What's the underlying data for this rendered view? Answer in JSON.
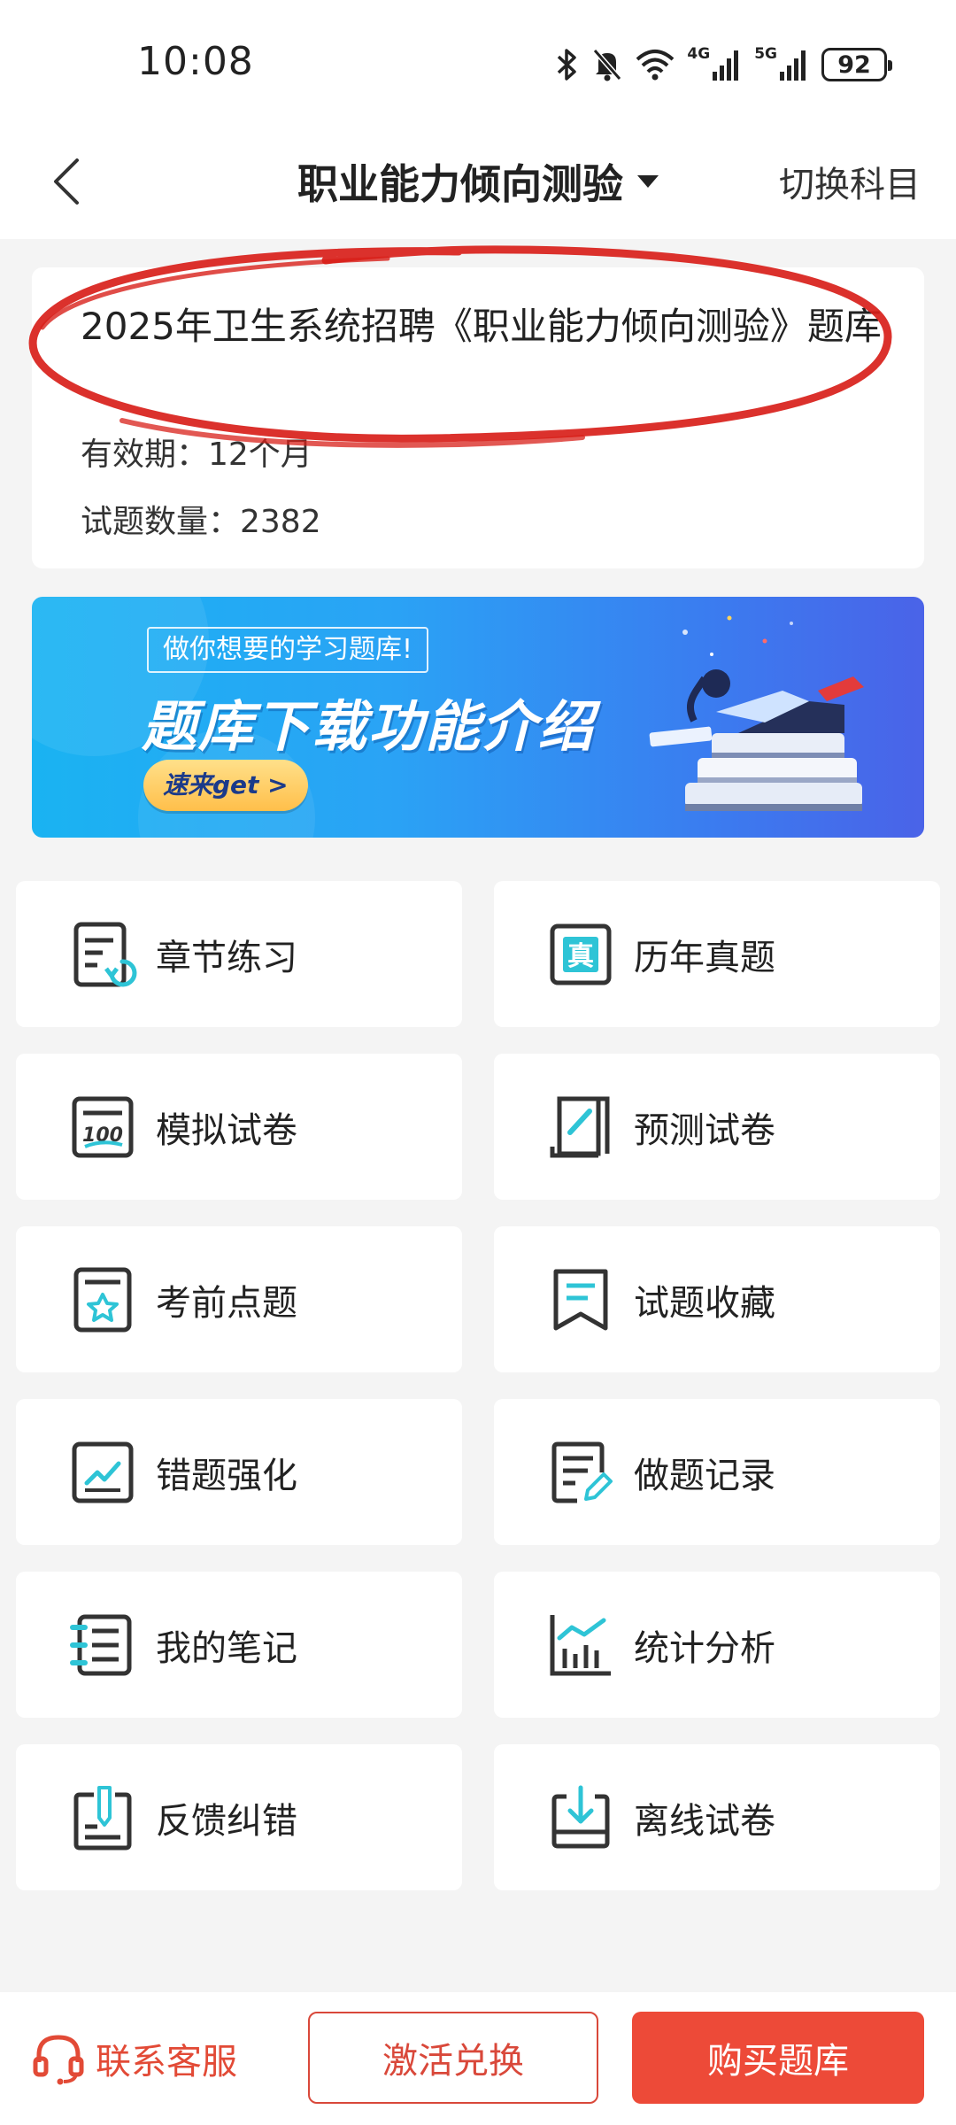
{
  "status_bar": {
    "time": "10:08",
    "net1_label": "4G",
    "net2_label": "5G",
    "battery": "92",
    "icons": [
      "bluetooth-icon",
      "mute-bell-icon",
      "wifi-icon",
      "signal-4g-icon",
      "signal-5g-icon",
      "battery-icon"
    ]
  },
  "nav": {
    "title": "职业能力倾向测验",
    "switch_label": "切换科目"
  },
  "info": {
    "title": "2025年卫生系统招聘《职业能力倾向测验》题库",
    "validity": "有效期：12个月",
    "question_count": "试题数量：2382"
  },
  "banner": {
    "tag": "做你想要的学习题库!",
    "headline": "题库下载功能介绍",
    "cta": "速来get >"
  },
  "menu": [
    {
      "label": "章节练习",
      "icon": "chapter-practice-icon"
    },
    {
      "label": "历年真题",
      "icon": "past-exams-icon"
    },
    {
      "label": "模拟试卷",
      "icon": "mock-paper-icon"
    },
    {
      "label": "预测试卷",
      "icon": "forecast-paper-icon"
    },
    {
      "label": "考前点题",
      "icon": "pre-exam-tips-icon"
    },
    {
      "label": "试题收藏",
      "icon": "bookmark-icon"
    },
    {
      "label": "错题强化",
      "icon": "wrong-questions-icon"
    },
    {
      "label": "做题记录",
      "icon": "practice-record-icon"
    },
    {
      "label": "我的笔记",
      "icon": "notes-icon"
    },
    {
      "label": "统计分析",
      "icon": "statistics-icon"
    },
    {
      "label": "反馈纠错",
      "icon": "feedback-icon"
    },
    {
      "label": "离线试卷",
      "icon": "offline-download-icon"
    }
  ],
  "bottom": {
    "contact_label": "联系客服",
    "activate_label": "激活兑换",
    "buy_label": "购买题库"
  },
  "colors": {
    "accent_red": "#ed4a38",
    "icon_dark": "#333333",
    "icon_cyan": "#2ec4d6",
    "banner_blue": "#2aa3f5"
  }
}
